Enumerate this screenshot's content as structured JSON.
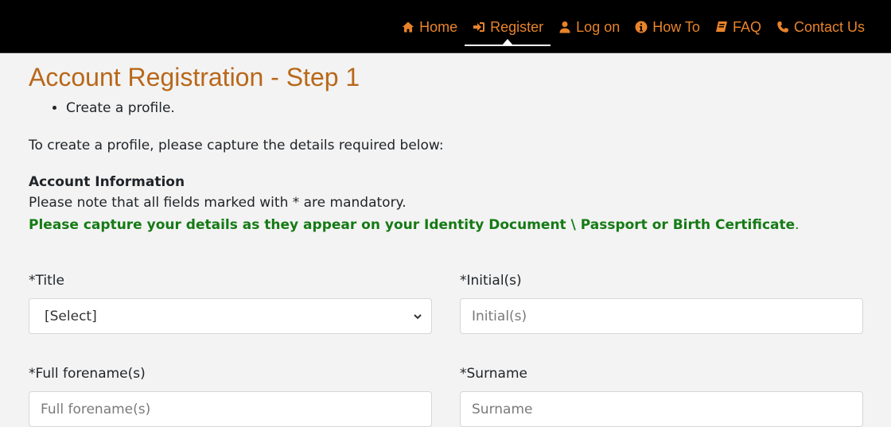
{
  "nav": {
    "items": [
      {
        "label": "Home",
        "icon": "home-icon",
        "active": false
      },
      {
        "label": "Register",
        "icon": "sign-in-icon",
        "active": true
      },
      {
        "label": "Log on",
        "icon": "user-icon",
        "active": false
      },
      {
        "label": "How To",
        "icon": "info-circle-icon",
        "active": false
      },
      {
        "label": "FAQ",
        "icon": "book-icon",
        "active": false
      },
      {
        "label": "Contact Us",
        "icon": "phone-icon",
        "active": false
      }
    ]
  },
  "page": {
    "title": "Account Registration - Step 1",
    "steps": [
      "Create a profile."
    ],
    "intro": "To create a profile, please capture the details required below:",
    "section_heading": "Account Information",
    "mandatory_note": "Please note that all fields marked with * are mandatory.",
    "green_note_bold": "Please capture your details as they appear on your Identity Document \\ Passport or Birth Certificate",
    "green_note_tail": "."
  },
  "form": {
    "title": {
      "label": "*Title",
      "selected": "[Select]"
    },
    "initials": {
      "label": "*Initial(s)",
      "placeholder": "Initial(s)",
      "value": ""
    },
    "forenames": {
      "label": "*Full forename(s)",
      "placeholder": "Full forename(s)",
      "value": ""
    },
    "surname": {
      "label": "*Surname",
      "placeholder": "Surname",
      "value": ""
    }
  },
  "colors": {
    "nav_background": "#000000",
    "nav_link": "#e8832a",
    "title": "#b8681a",
    "green_note": "#157a15",
    "page_background": "#f3f3f3"
  }
}
